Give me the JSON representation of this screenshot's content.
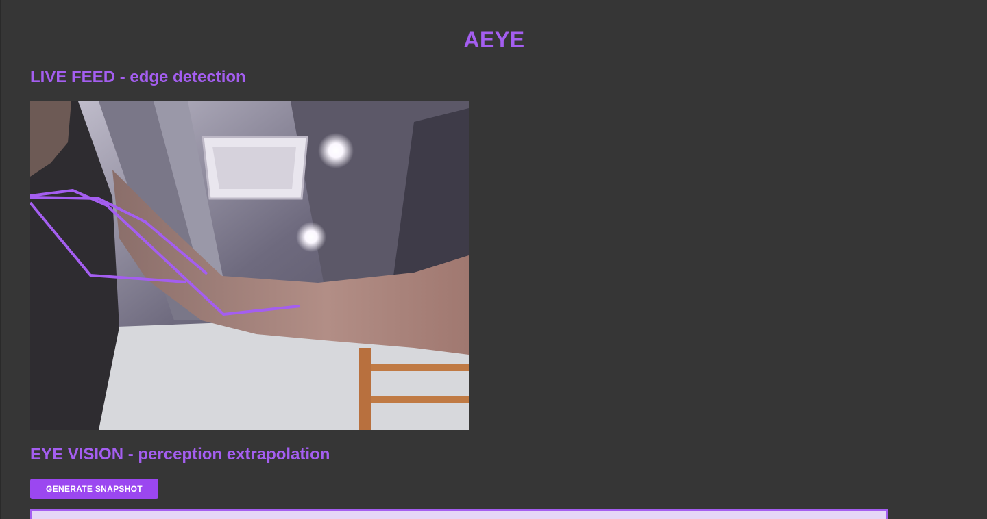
{
  "header": {
    "title": "AEYE"
  },
  "live_feed": {
    "heading": "LIVE FEED - edge detection"
  },
  "eye_vision": {
    "heading": "EYE VISION - perception extrapolation",
    "generate_button_label": "GENERATE SNAPSHOT"
  },
  "colors": {
    "background": "#363636",
    "accent": "#a45ef0",
    "button": "#9b47f0",
    "overlay_line": "#a45ef0"
  }
}
